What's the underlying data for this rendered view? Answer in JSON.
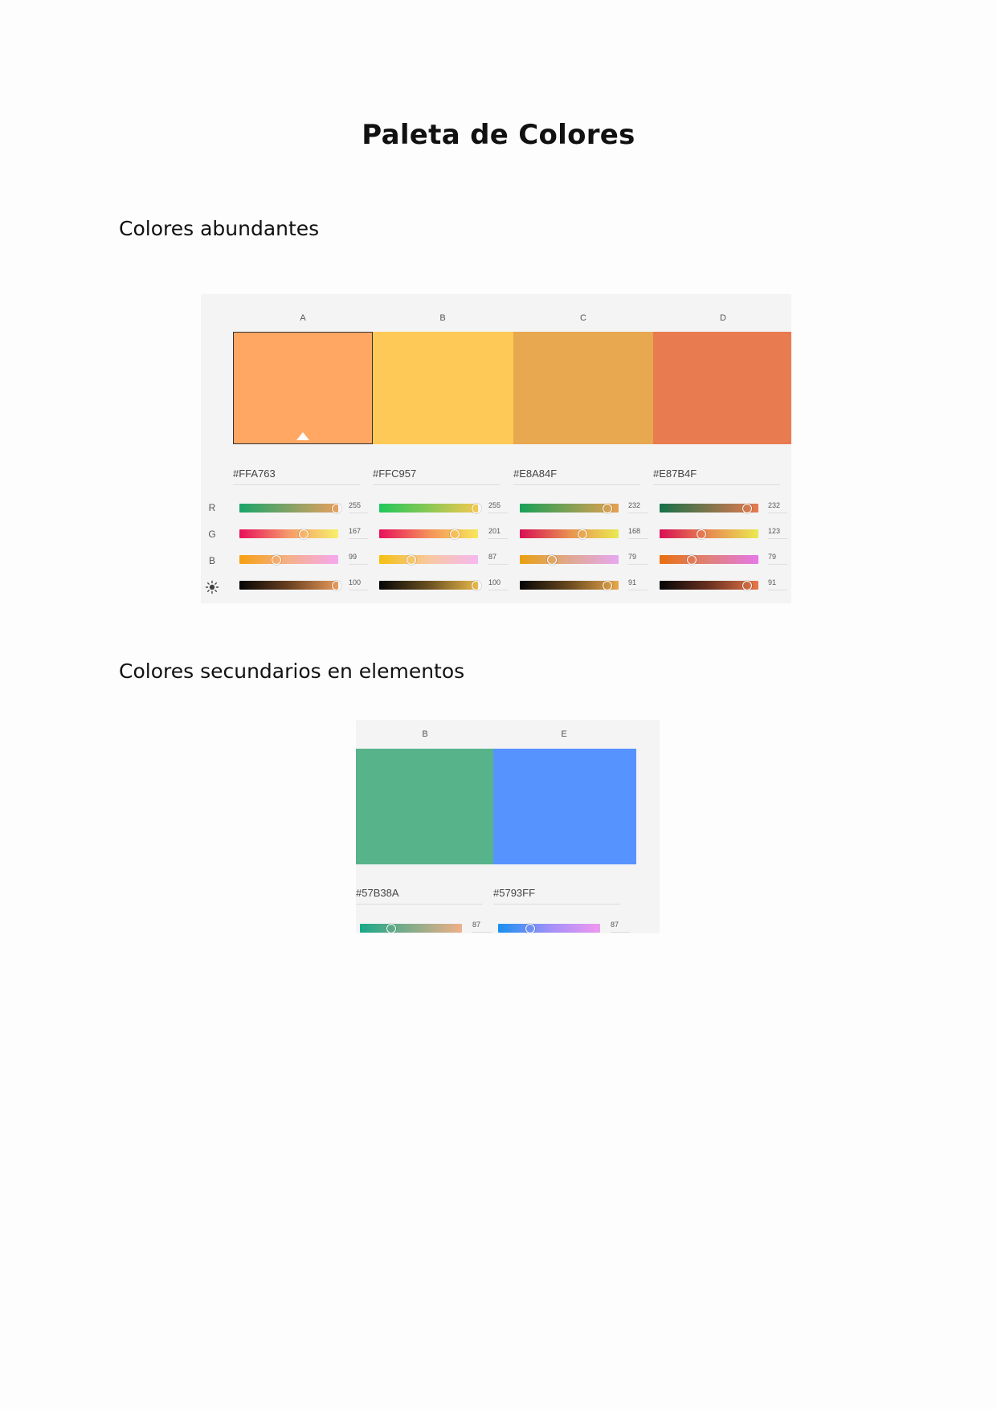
{
  "document": {
    "title": "Paleta de Colores",
    "section_main": "Colores abundantes",
    "section_secondary": "Colores secundarios en elementos"
  },
  "main_palette": {
    "channel_labels": [
      "R",
      "G",
      "B"
    ],
    "brightness_icon": "sun-icon",
    "swatches": [
      {
        "label": "A",
        "hex": "#FFA763",
        "color": "#FFA763",
        "selected": true,
        "r": "255",
        "g": "167",
        "b": "99",
        "brightness": "100"
      },
      {
        "label": "B",
        "hex": "#FFC957",
        "color": "#FFC957",
        "selected": false,
        "r": "255",
        "g": "201",
        "b": "87",
        "brightness": "100"
      },
      {
        "label": "C",
        "hex": "#E8A84F",
        "color": "#E8A84F",
        "selected": false,
        "r": "232",
        "g": "168",
        "b": "79",
        "brightness": "91"
      },
      {
        "label": "D",
        "hex": "#E87B4F",
        "color": "#E87B4F",
        "selected": false,
        "r": "232",
        "g": "123",
        "b": "79",
        "brightness": "91"
      }
    ]
  },
  "secondary_palette": {
    "swatches": [
      {
        "label": "B",
        "hex": "#57B38A",
        "color": "#57B38A",
        "value": "87"
      },
      {
        "label": "E",
        "hex": "#5793FF",
        "color": "#5793FF",
        "value": "87"
      }
    ]
  }
}
